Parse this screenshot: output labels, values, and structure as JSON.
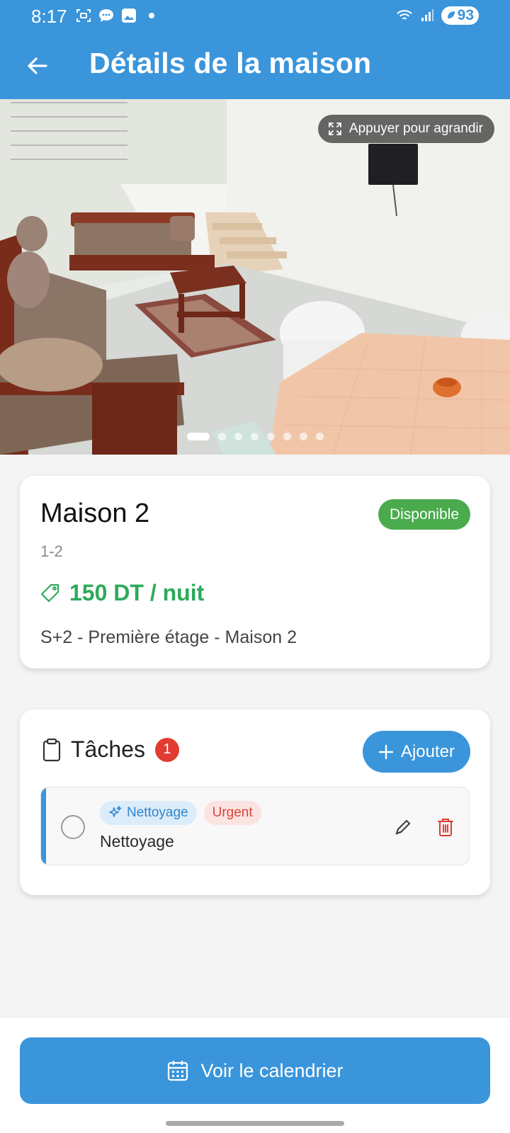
{
  "status_bar": {
    "time": "8:17",
    "battery": "93",
    "left_icons": [
      "face-scan-icon",
      "chat-bubble-icon",
      "gallery-icon",
      "dot-icon"
    ],
    "right_icons": [
      "wifi-icon",
      "signal-icon",
      "battery-saver-icon"
    ]
  },
  "app_bar": {
    "title": "Détails de la maison",
    "back_icon": "arrow-left-icon"
  },
  "gallery": {
    "zoom_hint": "Appuyer pour agrandir",
    "page_count": 8,
    "active_page": 1
  },
  "house": {
    "name": "Maison 2",
    "code": "1-2",
    "status": "Disponible",
    "price": "150 DT / nuit",
    "description": "S+2 - Première étage - Maison 2"
  },
  "tasks": {
    "title": "Tâches",
    "count": "1",
    "add_label": "Ajouter",
    "items": [
      {
        "category": "Nettoyage",
        "priority": "Urgent",
        "title": "Nettoyage"
      }
    ]
  },
  "footer": {
    "calendar_label": "Voir le calendrier"
  },
  "colors": {
    "primary": "#3a95db",
    "available": "#49ab4c",
    "price": "#2eaa5a",
    "urgent": "#e23b31"
  }
}
